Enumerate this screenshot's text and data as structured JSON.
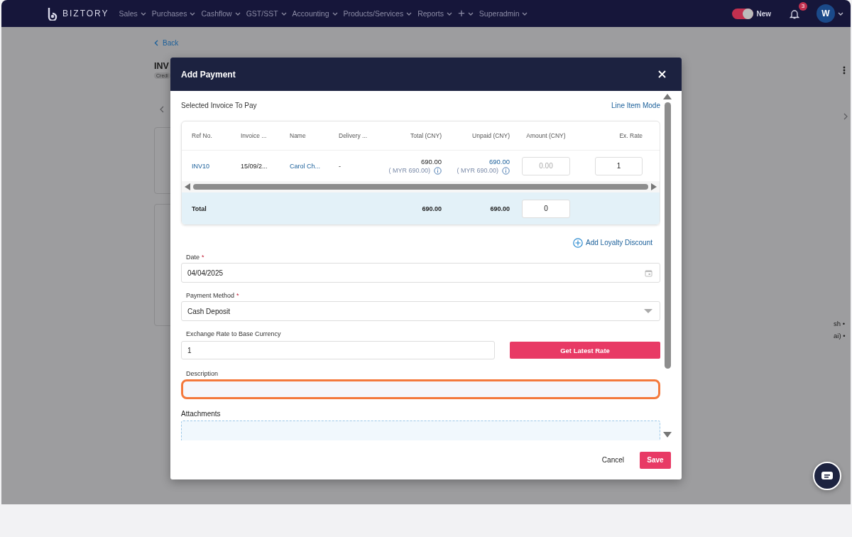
{
  "nav": {
    "brand": "BIZTORY",
    "menu": [
      {
        "label": "Sales",
        "kind": "text"
      },
      {
        "label": "Purchases",
        "kind": "text"
      },
      {
        "label": "Cashflow",
        "kind": "text"
      },
      {
        "label": "GST/SST",
        "kind": "text"
      },
      {
        "label": "Accounting",
        "kind": "text"
      },
      {
        "label": "Products/Services",
        "kind": "text"
      },
      {
        "label": "Reports",
        "kind": "text"
      },
      {
        "label": "+",
        "kind": "plus"
      },
      {
        "label": "Superadmin",
        "kind": "text"
      }
    ],
    "toggle": {
      "label": "New",
      "on": true
    },
    "notifications": "3",
    "avatar": "W"
  },
  "background": {
    "back": "Back",
    "title": "INV",
    "tag": "Credi",
    "side_texts": [
      "sh •",
      "ai) •"
    ]
  },
  "modal": {
    "title": "Add Payment",
    "section_label": "Selected Invoice To Pay",
    "mode_link": "Line Item Mode",
    "table": {
      "columns": [
        "Ref No.",
        "Invoice ...",
        "Name",
        "Delivery ...",
        "Total (CNY)",
        "Unpaid (CNY)",
        "Amount (CNY)",
        "Ex. Rate"
      ],
      "rows": [
        {
          "ref": "INV10",
          "invoice_date": "15/09/2...",
          "name": "Carol Ch...",
          "delivery": "-",
          "total": "690.00",
          "total_base": "( MYR 690.00)",
          "unpaid": "690.00",
          "unpaid_base": "( MYR 690.00)",
          "amount_placeholder": "0.00",
          "ex_rate": "1"
        }
      ],
      "total_row": {
        "label": "Total",
        "total": "690.00",
        "unpaid": "690.00",
        "amount": "0"
      }
    },
    "loyalty_link": "Add Loyalty Discount",
    "fields": [
      {
        "kind": "date",
        "label": "Date",
        "required_mark": "*",
        "value": "04/04/2025",
        "focused": false
      },
      {
        "kind": "select",
        "label": "Payment Method",
        "required_mark": "*",
        "value": "Cash Deposit",
        "focused": false
      },
      {
        "kind": "rate",
        "label": "Exchange Rate to Base Currency",
        "value": "1",
        "button": "Get Latest Rate",
        "focused": false
      },
      {
        "kind": "text",
        "label": "Description",
        "focused": true
      },
      {
        "kind": "upload",
        "label": "Attachments"
      }
    ],
    "buttons": [
      {
        "label": "Cancel",
        "kind": "plain"
      },
      {
        "label": "Save",
        "kind": "primary"
      }
    ]
  }
}
